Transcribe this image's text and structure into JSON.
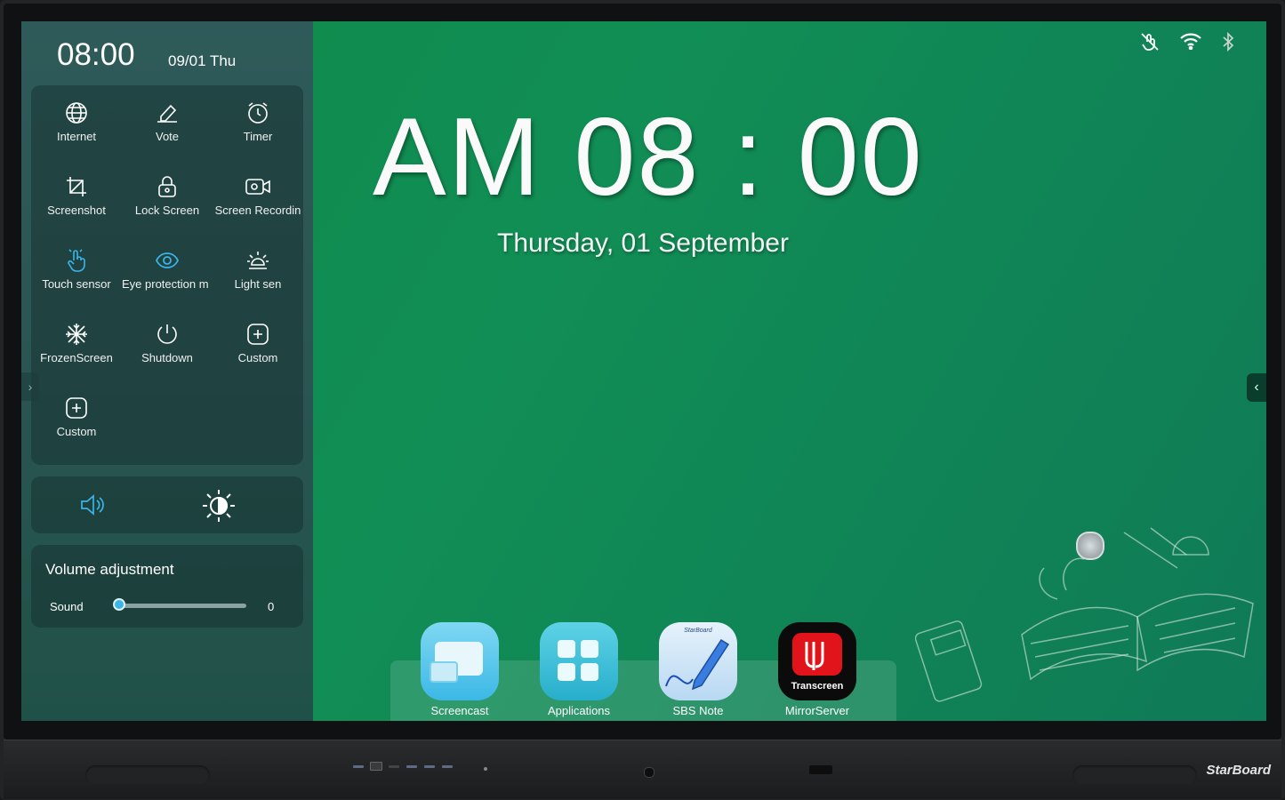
{
  "panel": {
    "time": "08:00",
    "date": "09/01 Thu",
    "tiles": [
      {
        "label": "Internet",
        "icon": "globe-icon"
      },
      {
        "label": "Vote",
        "icon": "pen-icon"
      },
      {
        "label": "Timer",
        "icon": "alarm-clock-icon"
      },
      {
        "label": "Screenshot",
        "icon": "crop-icon"
      },
      {
        "label": "Lock Screen",
        "icon": "lock-icon"
      },
      {
        "label": "Screen Recordin",
        "icon": "video-camera-icon"
      },
      {
        "label": "Touch sensor",
        "icon": "hand-touch-icon"
      },
      {
        "label": "Eye protection m n",
        "icon": "eye-icon"
      },
      {
        "label": "Light sen",
        "icon": "light-bulb-icon"
      },
      {
        "label": "FrozenScreen",
        "icon": "snowflake-icon"
      },
      {
        "label": "Shutdown",
        "icon": "power-icon"
      },
      {
        "label": "Custom",
        "icon": "add-square-icon"
      },
      {
        "label": "Custom",
        "icon": "add-square-icon"
      }
    ],
    "volume": {
      "title": "Volume adjustment",
      "label": "Sound",
      "value": "0",
      "level": 0
    }
  },
  "main": {
    "clock": "AM 08 : 00",
    "date": "Thursday, 01 September"
  },
  "dock": {
    "apps": [
      {
        "label": "Screencast"
      },
      {
        "label": "Applications"
      },
      {
        "label": "SBS Note",
        "badge": "StarBoard"
      },
      {
        "label": "MirrorServer",
        "badge": "Transcreen"
      }
    ]
  },
  "device": {
    "brand": "StarBoard"
  },
  "colors": {
    "screen": "#118e55",
    "panel": "#2b5756",
    "accent": "#3ab5e8"
  }
}
